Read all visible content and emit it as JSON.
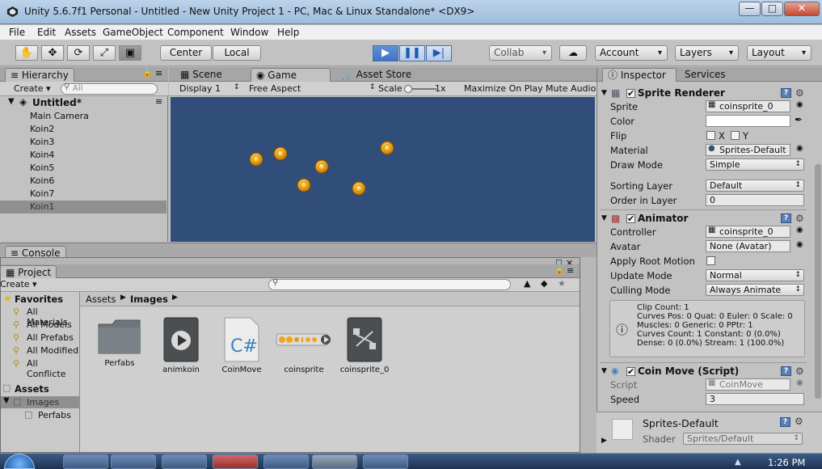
{
  "window": {
    "title": "Unity 5.6.7f1 Personal - Untitled - New Unity Project 1 - PC, Mac & Linux Standalone* <DX9>"
  },
  "menu": [
    "File",
    "Edit",
    "Assets",
    "GameObject",
    "Component",
    "Window",
    "Help"
  ],
  "toolbar": {
    "center": "Center",
    "local": "Local",
    "collab": "Collab",
    "account": "Account",
    "layers": "Layers",
    "layout": "Layout"
  },
  "hierarchy": {
    "tab": "Hierarchy",
    "create": "Create",
    "search_placeholder": "All",
    "scene": "Untitled*",
    "items": [
      "Main Camera",
      "Koin2",
      "Koin3",
      "Koin4",
      "Koin5",
      "Koin6",
      "Koin7",
      "Koin1"
    ],
    "selected_index": 7
  },
  "tabs": {
    "scene": "Scene",
    "game": "Game",
    "asset_store": "Asset Store",
    "console": "Console"
  },
  "game": {
    "display": "Display 1",
    "aspect": "Free Aspect",
    "scale_label": "Scale",
    "scale_value": "1x",
    "maximize": "Maximize On Play",
    "mute": "Mute Audio",
    "bg_color": "#314d79"
  },
  "project": {
    "tab": "Project",
    "create": "Create",
    "favorites_label": "Favorites",
    "favorites": [
      "All Materials",
      "All Models",
      "All Prefabs",
      "All Modified",
      "All Conflicte"
    ],
    "assets_label": "Assets",
    "tree": [
      "Images",
      "Perfabs"
    ],
    "breadcrumb": [
      "Assets",
      "Images"
    ],
    "items": [
      {
        "label": "Perfabs",
        "icon": "folder-icon"
      },
      {
        "label": "animkoin",
        "icon": "animation-clip-icon"
      },
      {
        "label": "CoinMove",
        "icon": "csharp-script-icon"
      },
      {
        "label": "coinsprite",
        "icon": "sprite-sheet-icon"
      },
      {
        "label": "coinsprite_0",
        "icon": "animator-controller-icon"
      }
    ]
  },
  "inspector": {
    "tab": "Inspector",
    "services_tab": "Services",
    "sprite_renderer": {
      "title": "Sprite Renderer",
      "sprite_label": "Sprite",
      "sprite_value": "coinsprite_0",
      "color_label": "Color",
      "flip_label": "Flip",
      "flip_x": "X",
      "flip_y": "Y",
      "material_label": "Material",
      "material_value": "Sprites-Default",
      "draw_mode_label": "Draw Mode",
      "draw_mode_value": "Simple",
      "sorting_layer_label": "Sorting Layer",
      "sorting_layer_value": "Default",
      "order_label": "Order in Layer",
      "order_value": "0"
    },
    "animator": {
      "title": "Animator",
      "controller_label": "Controller",
      "controller_value": "coinsprite_0",
      "avatar_label": "Avatar",
      "avatar_value": "None (Avatar)",
      "root_motion_label": "Apply Root Motion",
      "update_label": "Update Mode",
      "update_value": "Normal",
      "culling_label": "Culling Mode",
      "culling_value": "Always Animate",
      "info": [
        "Clip Count: 1",
        "Curves Pos: 0 Quat: 0 Euler: 0 Scale: 0",
        "Muscles: 0 Generic: 0 PPtr: 1",
        "Curves Count: 1 Constant: 0 (0.0%)",
        "Dense: 0 (0.0%) Stream: 1 (100.0%)"
      ]
    },
    "coin_move": {
      "title": "Coin Move (Script)",
      "script_label": "Script",
      "script_value": "CoinMove",
      "speed_label": "Speed",
      "speed_value": "3"
    },
    "material": {
      "name": "Sprites-Default",
      "shader_label": "Shader",
      "shader_value": "Sprites/Default"
    }
  },
  "taskbar": {
    "time": "1:26 PM"
  }
}
